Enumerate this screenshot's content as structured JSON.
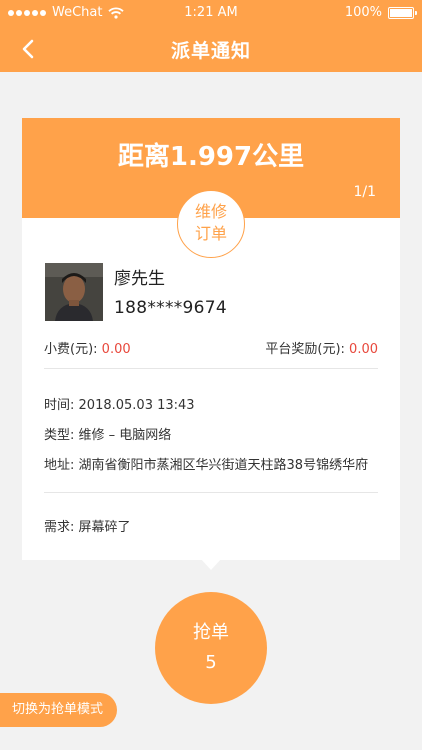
{
  "status_bar": {
    "carrier": "WeChat",
    "time": "1:21 AM",
    "battery": "100%"
  },
  "nav": {
    "title": "派单通知",
    "back_icon": "chevron-left-icon"
  },
  "card": {
    "distance": "距离1.997公里",
    "page_count": "1/1",
    "order_type_line1": "维修",
    "order_type_line2": "订单",
    "customer_name": "廖先生",
    "customer_phone": "188****9674",
    "fee_label": "小费(元):",
    "fee_value": "0.00",
    "reward_label": "平台奖励(元):",
    "reward_value": "0.00",
    "time_label": "时间:",
    "time_value": "2018.05.03  13:43",
    "type_label": "类型:",
    "type_value": "维修 – 电脑网络",
    "address_label": "地址:",
    "address_value": "湖南省衡阳市蒸湘区华兴街道天柱路38号锦绣华府",
    "need_label": "需求:",
    "need_value": "屏幕碎了"
  },
  "grab_button": {
    "label": "抢单",
    "count": "5"
  },
  "mode_button": {
    "label": "切换为抢单模式"
  },
  "colors": {
    "accent": "#ffa24a",
    "amount": "#e8483c"
  }
}
